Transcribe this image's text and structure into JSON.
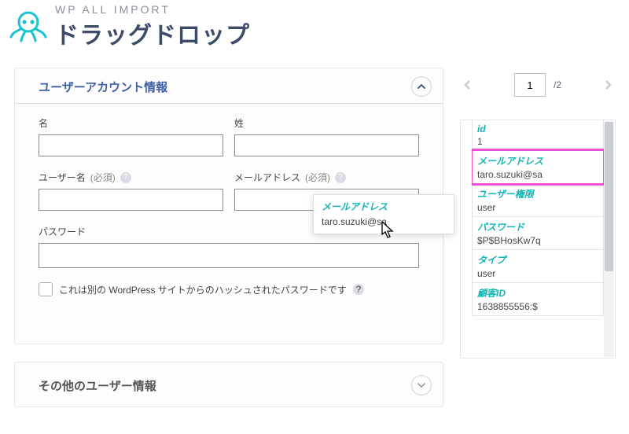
{
  "brand": {
    "small": "WP ALL IMPORT",
    "big": "ドラッグドロップ"
  },
  "panel1": {
    "title": "ユーザーアカウント情報",
    "firstName": "名",
    "lastName": "姓",
    "username": "ユーザー名",
    "required": "(必須)",
    "email": "メールアドレス",
    "password": "パスワード",
    "checkbox": "これは別の WordPress サイトからのハッシュされたパスワードです",
    "values": {
      "firstName": "",
      "lastName": "",
      "username": "",
      "email": "",
      "password": ""
    }
  },
  "panel2": {
    "title": "その他のユーザー情報"
  },
  "pager": {
    "page": "1",
    "total": "/2"
  },
  "sheet": [
    {
      "k": "id",
      "v": "1"
    },
    {
      "k": "メールアドレス",
      "v": "taro.suzuki@sa",
      "selected": true
    },
    {
      "k": "ユーザー権限",
      "v": "user"
    },
    {
      "k": "パスワード",
      "v": "$P$BHosKw7q"
    },
    {
      "k": "タイプ",
      "v": "user"
    },
    {
      "k": "顧客ID",
      "v": "1638855556:$"
    }
  ],
  "drag": {
    "k": "メールアドレス",
    "v": "taro.suzuki@sa"
  }
}
